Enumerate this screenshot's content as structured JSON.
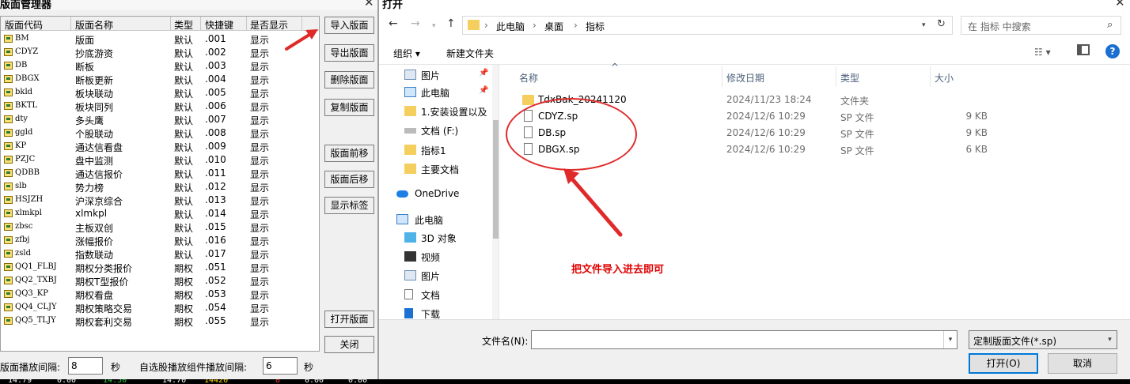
{
  "layout_manager": {
    "title": "版面管理器",
    "columns": [
      "版面代码",
      "版面名称",
      "类型",
      "快捷键",
      "是否显示"
    ],
    "rows": [
      {
        "code": "BM",
        "name": "版面",
        "type": "默认",
        "key": ".001",
        "show": "显示"
      },
      {
        "code": "CDYZ",
        "name": "抄底游资",
        "type": "默认",
        "key": ".002",
        "show": "显示"
      },
      {
        "code": "DB",
        "name": "断板",
        "type": "默认",
        "key": ".003",
        "show": "显示"
      },
      {
        "code": "DBGX",
        "name": "断板更新",
        "type": "默认",
        "key": ".004",
        "show": "显示"
      },
      {
        "code": "bkld",
        "name": "板块联动",
        "type": "默认",
        "key": ".005",
        "show": "显示"
      },
      {
        "code": "BKTL",
        "name": "板块同列",
        "type": "默认",
        "key": ".006",
        "show": "显示"
      },
      {
        "code": "dty",
        "name": "多头鹰",
        "type": "默认",
        "key": ".007",
        "show": "显示"
      },
      {
        "code": "ggld",
        "name": "个股联动",
        "type": "默认",
        "key": ".008",
        "show": "显示"
      },
      {
        "code": "KP",
        "name": "通达信看盘",
        "type": "默认",
        "key": ".009",
        "show": "显示"
      },
      {
        "code": "PZJC",
        "name": "盘中监测",
        "type": "默认",
        "key": ".010",
        "show": "显示"
      },
      {
        "code": "QDBB",
        "name": "通达信报价",
        "type": "默认",
        "key": ".011",
        "show": "显示"
      },
      {
        "code": "slb",
        "name": "势力榜",
        "type": "默认",
        "key": ".012",
        "show": "显示"
      },
      {
        "code": "HSJZH",
        "name": "沪深京综合",
        "type": "默认",
        "key": ".013",
        "show": "显示"
      },
      {
        "code": "xlmkpl",
        "name": "xlmkpl",
        "type": "默认",
        "key": ".014",
        "show": "显示"
      },
      {
        "code": "zbsc",
        "name": "主板双创",
        "type": "默认",
        "key": ".015",
        "show": "显示"
      },
      {
        "code": "zfbj",
        "name": "涨幅报价",
        "type": "默认",
        "key": ".016",
        "show": "显示"
      },
      {
        "code": "zsld",
        "name": "指数联动",
        "type": "默认",
        "key": ".017",
        "show": "显示"
      },
      {
        "code": "QQ1_FLBJ",
        "name": "期权分类报价",
        "type": "期权",
        "key": ".051",
        "show": "显示"
      },
      {
        "code": "QQ2_TXBJ",
        "name": "期权T型报价",
        "type": "期权",
        "key": ".052",
        "show": "显示"
      },
      {
        "code": "QQ3_KP",
        "name": "期权看盘",
        "type": "期权",
        "key": ".053",
        "show": "显示"
      },
      {
        "code": "QQ4_CLJY",
        "name": "期权策略交易",
        "type": "期权",
        "key": ".054",
        "show": "显示"
      },
      {
        "code": "QQ5_TLJY",
        "name": "期权套利交易",
        "type": "期权",
        "key": ".055",
        "show": "显示"
      }
    ],
    "buttons": {
      "import": "导入版面",
      "export": "导出版面",
      "delete": "删除版面",
      "copy": "复制版面",
      "move_up": "版面前移",
      "move_down": "版面后移",
      "show_tags": "显示标签",
      "open": "打开版面",
      "close": "关闭"
    },
    "bottom": {
      "interval_label": "版面播放间隔:",
      "interval_value": "8",
      "interval_unit": "秒",
      "widget_interval_label": "自选股播放组件播放间隔:",
      "widget_interval_value": "6",
      "widget_interval_unit": "秒"
    },
    "colors": {
      "arrow": "#e02a2a"
    }
  },
  "ticker": [
    "14.79",
    "0.00",
    "14.50",
    "14.70",
    "14420",
    "8",
    "0.00",
    "0.00"
  ],
  "open_dialog": {
    "title": "打开",
    "breadcrumb": [
      "此电脑",
      "桌面",
      "指标"
    ],
    "search_placeholder": "在 指标 中搜索",
    "toolbar": {
      "organize": "组织 ▾",
      "new_folder": "新建文件夹"
    },
    "nav_items": [
      {
        "label": "图片",
        "icon": "pictures-icon",
        "pinned": true
      },
      {
        "label": "此电脑",
        "icon": "computer-icon",
        "pinned": true
      },
      {
        "label": "1.安装设置以及",
        "icon": "folder-icon",
        "pinned": false
      },
      {
        "label": "文档 (F:)",
        "icon": "drive-icon",
        "pinned": false
      },
      {
        "label": "指标1",
        "icon": "folder-icon",
        "pinned": false
      },
      {
        "label": "主要文档",
        "icon": "folder-icon",
        "pinned": false
      },
      {
        "label": "OneDrive",
        "icon": "cloud-icon",
        "pinned": false
      },
      {
        "label": "此电脑",
        "icon": "computer-icon",
        "pinned": false
      },
      {
        "label": "3D 对象",
        "icon": "cube-icon",
        "pinned": false
      },
      {
        "label": "视频",
        "icon": "video-icon",
        "pinned": false
      },
      {
        "label": "图片",
        "icon": "pictures-icon",
        "pinned": false
      },
      {
        "label": "文档",
        "icon": "document-icon",
        "pinned": false
      },
      {
        "label": "下载",
        "icon": "download-icon",
        "pinned": false
      }
    ],
    "columns": {
      "name": "名称",
      "modified": "修改日期",
      "type": "类型",
      "size": "大小"
    },
    "files": [
      {
        "name": "TdxBak_20241120",
        "modified": "2024/11/23 18:24",
        "type": "文件夹",
        "size": "",
        "kind": "folder"
      },
      {
        "name": "CDYZ.sp",
        "modified": "2024/12/6 10:29",
        "type": "SP 文件",
        "size": "9 KB",
        "kind": "file"
      },
      {
        "name": "DB.sp",
        "modified": "2024/12/6 10:29",
        "type": "SP 文件",
        "size": "9 KB",
        "kind": "file"
      },
      {
        "name": "DBGX.sp",
        "modified": "2024/12/6 10:29",
        "type": "SP 文件",
        "size": "6 KB",
        "kind": "file"
      }
    ],
    "annotation": "把文件导入进去即可",
    "filename_label": "文件名(N):",
    "filename_value": "",
    "filetype": "定制版面文件(*.sp)",
    "open_button": "打开(O)",
    "cancel_button": "取消",
    "colors": {
      "annotation": "#e00000",
      "folder": "#f5cf5d",
      "help": "#1a6fd1"
    }
  }
}
